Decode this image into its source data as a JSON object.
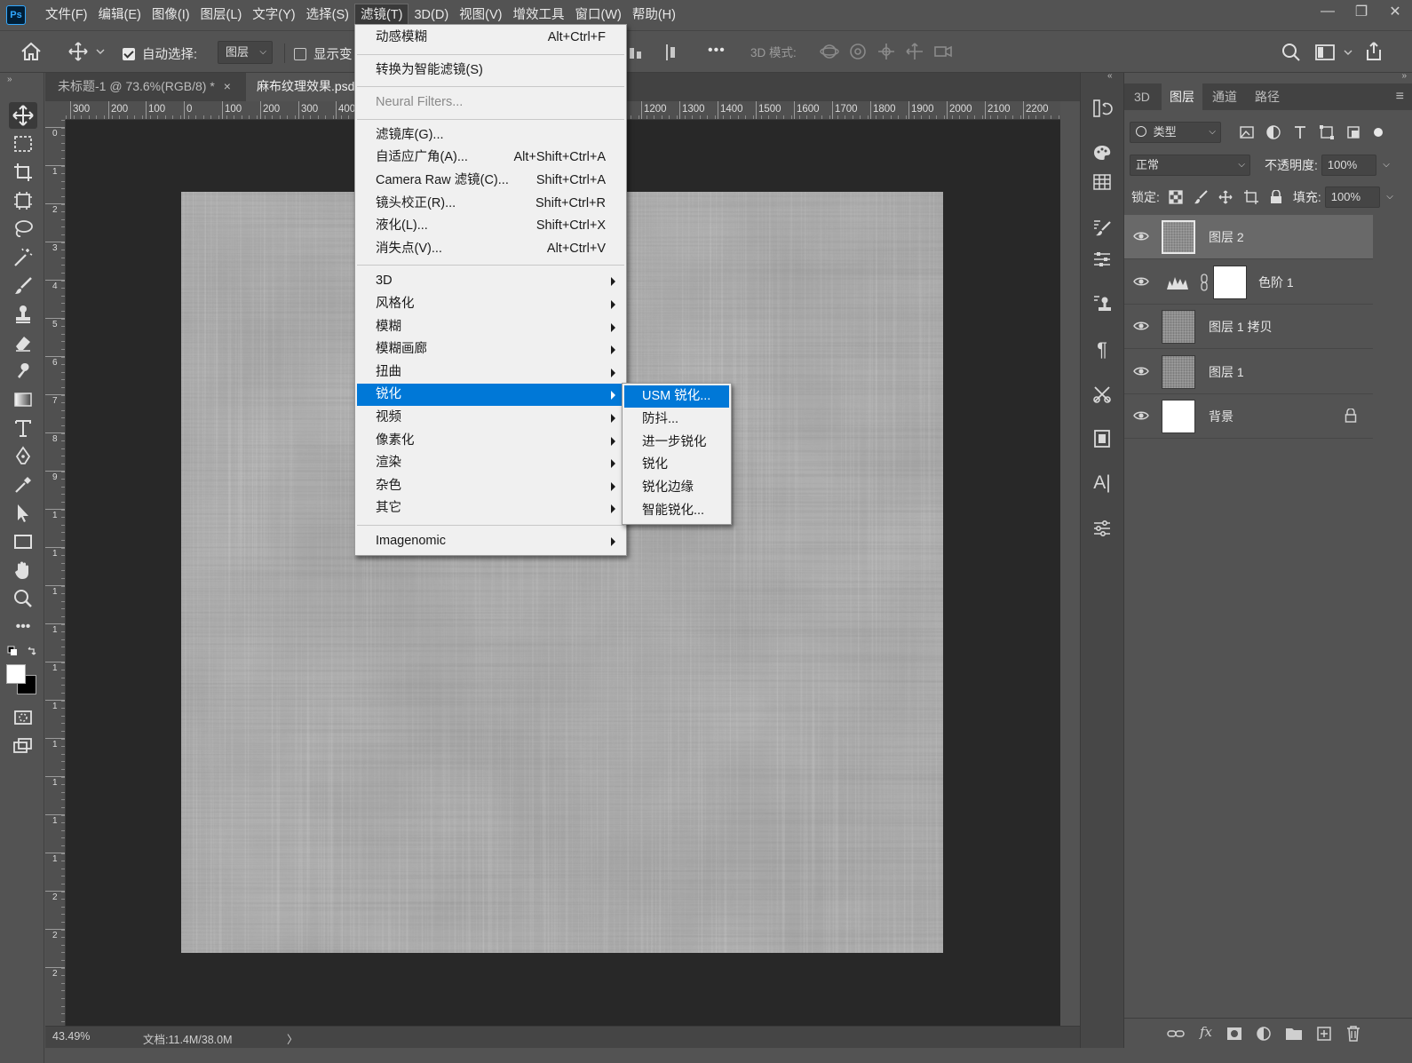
{
  "menubar": {
    "logo": "Ps",
    "items": [
      "文件(F)",
      "编辑(E)",
      "图像(I)",
      "图层(L)",
      "文字(Y)",
      "选择(S)",
      "滤镜(T)",
      "3D(D)",
      "视图(V)",
      "增效工具",
      "窗口(W)",
      "帮助(H)"
    ],
    "active_index": 6
  },
  "window_controls": {
    "minimize": "—",
    "restore": "❐",
    "close": "✕"
  },
  "options_bar": {
    "auto_select_label": "自动选择:",
    "auto_select_checked": true,
    "auto_select_target": "图层",
    "show_transform_label": "显示变",
    "show_transform_checked": false,
    "more": "•••",
    "mode_3d_label": "3D 模式:"
  },
  "doc_tabs": [
    {
      "label": "未标题-1 @ 73.6%(RGB/8) *",
      "close": "×",
      "active": false
    },
    {
      "label": "麻布纹理效果.psd",
      "active": true
    }
  ],
  "ruler_top_labels": [
    "300",
    "200",
    "100",
    "0",
    "100",
    "200",
    "300",
    "400",
    "1200",
    "1300",
    "1400",
    "1500",
    "1600",
    "1700",
    "1800",
    "1900",
    "2000",
    "2100",
    "2200"
  ],
  "ruler_left_labels": [
    "0",
    "1",
    "2",
    "3",
    "4",
    "5",
    "6",
    "7",
    "8",
    "9",
    "1",
    "1",
    "1",
    "1",
    "1",
    "1",
    "1",
    "1",
    "1",
    "1",
    "2",
    "2",
    "2"
  ],
  "status": {
    "zoom": "43.49%",
    "doc_info": "文档:11.4M/38.0M",
    "arrow": "〉"
  },
  "filter_menu": {
    "items": [
      {
        "label": "动感模糊",
        "shortcut": "Alt+Ctrl+F"
      },
      {
        "sep": true
      },
      {
        "label": "转换为智能滤镜(S)"
      },
      {
        "sep": true
      },
      {
        "label": "Neural Filters...",
        "disabled": true
      },
      {
        "sep": true
      },
      {
        "label": "滤镜库(G)..."
      },
      {
        "label": "自适应广角(A)...",
        "shortcut": "Alt+Shift+Ctrl+A"
      },
      {
        "label": "Camera Raw 滤镜(C)...",
        "shortcut": "Shift+Ctrl+A"
      },
      {
        "label": "镜头校正(R)...",
        "shortcut": "Shift+Ctrl+R"
      },
      {
        "label": "液化(L)...",
        "shortcut": "Shift+Ctrl+X"
      },
      {
        "label": "消失点(V)...",
        "shortcut": "Alt+Ctrl+V"
      },
      {
        "sep": true
      },
      {
        "label": "3D",
        "submenu": true
      },
      {
        "label": "风格化",
        "submenu": true
      },
      {
        "label": "模糊",
        "submenu": true
      },
      {
        "label": "模糊画廊",
        "submenu": true
      },
      {
        "label": "扭曲",
        "submenu": true
      },
      {
        "label": "锐化",
        "submenu": true,
        "highlighted": true
      },
      {
        "label": "视频",
        "submenu": true
      },
      {
        "label": "像素化",
        "submenu": true
      },
      {
        "label": "渲染",
        "submenu": true
      },
      {
        "label": "杂色",
        "submenu": true
      },
      {
        "label": "其它",
        "submenu": true
      },
      {
        "sep": true
      },
      {
        "label": "Imagenomic",
        "submenu": true
      }
    ]
  },
  "sharpen_submenu": {
    "items": [
      {
        "label": "USM 锐化...",
        "highlighted": true
      },
      {
        "label": "防抖..."
      },
      {
        "label": "进一步锐化"
      },
      {
        "label": "锐化"
      },
      {
        "label": "锐化边缘"
      },
      {
        "label": "智能锐化..."
      }
    ]
  },
  "panel": {
    "tabs": [
      "3D",
      "图层",
      "通道",
      "路径"
    ],
    "active_tab": 1,
    "menu": "≡",
    "kind_filter": "类型",
    "blend_mode": "正常",
    "opacity_label": "不透明度:",
    "opacity_value": "100%",
    "lock_label": "锁定:",
    "fill_label": "填充:",
    "fill_value": "100%",
    "layers": [
      {
        "name": "图层 2",
        "type": "texture",
        "selected": true
      },
      {
        "name": "色阶 1",
        "type": "adjustment",
        "selected": false
      },
      {
        "name": "图层 1 拷贝",
        "type": "texture",
        "selected": false
      },
      {
        "name": "图层 1",
        "type": "texture",
        "selected": false
      },
      {
        "name": "背景",
        "type": "white",
        "selected": false,
        "locked": true
      }
    ]
  },
  "colors": {
    "ui_bg": "#535353",
    "menu_bg": "#f0f0f0",
    "menu_highlight": "#0078d7",
    "pasteboard": "#282828"
  }
}
